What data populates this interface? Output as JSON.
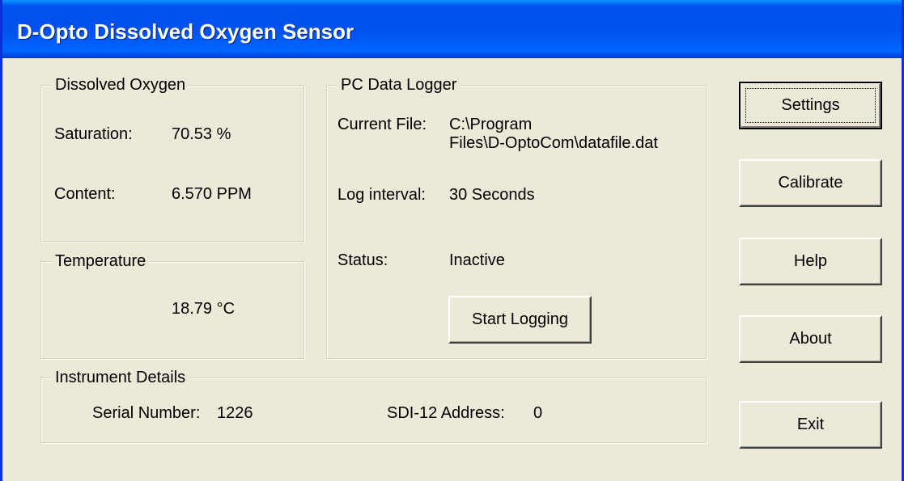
{
  "window": {
    "title": "D-Opto Dissolved Oxygen Sensor"
  },
  "dissolved_oxygen": {
    "group_label": "Dissolved Oxygen",
    "saturation_label": "Saturation:",
    "saturation_value": "70.53 %",
    "content_label": "Content:",
    "content_value": "6.570 PPM"
  },
  "temperature": {
    "group_label": "Temperature",
    "value": "18.79 °C"
  },
  "data_logger": {
    "group_label": "PC Data Logger",
    "current_file_label": "Current File:",
    "current_file_line1": "C:\\Program",
    "current_file_line2": "Files\\D-OptoCom\\datafile.dat",
    "log_interval_label": "Log interval:",
    "log_interval_value": "30 Seconds",
    "status_label": "Status:",
    "status_value": "Inactive",
    "start_button": "Start Logging"
  },
  "instrument": {
    "group_label": "Instrument Details",
    "serial_label": "Serial Number:",
    "serial_value": "1226",
    "sdi_label": "SDI-12 Address:",
    "sdi_value": "0"
  },
  "buttons": {
    "settings": "Settings",
    "calibrate": "Calibrate",
    "help": "Help",
    "about": "About",
    "exit": "Exit"
  },
  "colors": {
    "titlebar": "#0053ee",
    "dialog_bg": "#ece9d8",
    "border_accent": "#0831d9"
  }
}
